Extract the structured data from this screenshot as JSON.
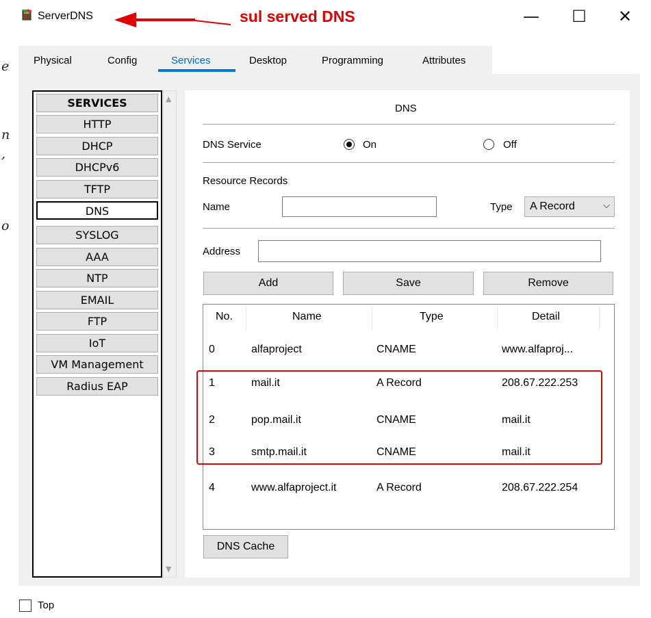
{
  "window": {
    "title": "ServerDNS",
    "annotation": "sul served DNS",
    "controls": {
      "minimize": "—",
      "maximize": "☐",
      "close": "✕"
    }
  },
  "side_fragments": [
    "e",
    "n",
    ",",
    "o"
  ],
  "tabs": [
    "Physical",
    "Config",
    "Services",
    "Desktop",
    "Programming",
    "Attributes"
  ],
  "active_tab": "Services",
  "services": {
    "header": "SERVICES",
    "items": [
      "HTTP",
      "DHCP",
      "DHCPv6",
      "TFTP",
      "DNS",
      "SYSLOG",
      "AAA",
      "NTP",
      "EMAIL",
      "FTP",
      "IoT",
      "VM Management",
      "Radius EAP"
    ],
    "selected": "DNS"
  },
  "dns": {
    "title": "DNS",
    "service_label": "DNS Service",
    "on_label": "On",
    "off_label": "Off",
    "service_state": "On",
    "resource_records_label": "Resource Records",
    "name_label": "Name",
    "name_value": "",
    "type_label": "Type",
    "type_value": "A Record",
    "address_label": "Address",
    "address_value": "",
    "buttons": {
      "add": "Add",
      "save": "Save",
      "remove": "Remove",
      "cache": "DNS Cache"
    },
    "table": {
      "columns": [
        "No.",
        "Name",
        "Type",
        "Detail"
      ],
      "rows": [
        {
          "no": "0",
          "name": "alfaproject",
          "type": "CNAME",
          "detail": "www.alfaproj..."
        },
        {
          "no": "1",
          "name": "mail.it",
          "type": "A Record",
          "detail": "208.67.222.253"
        },
        {
          "no": "2",
          "name": "pop.mail.it",
          "type": "CNAME",
          "detail": "mail.it"
        },
        {
          "no": "3",
          "name": "smtp.mail.it",
          "type": "CNAME",
          "detail": "mail.it"
        },
        {
          "no": "4",
          "name": "www.alfaproject.it",
          "type": "A Record",
          "detail": "208.67.222.254"
        }
      ]
    }
  },
  "footer": {
    "top_label": "Top",
    "top_checked": false
  },
  "colors": {
    "annotation": "#e00000",
    "tab_accent": "#0078d7"
  }
}
